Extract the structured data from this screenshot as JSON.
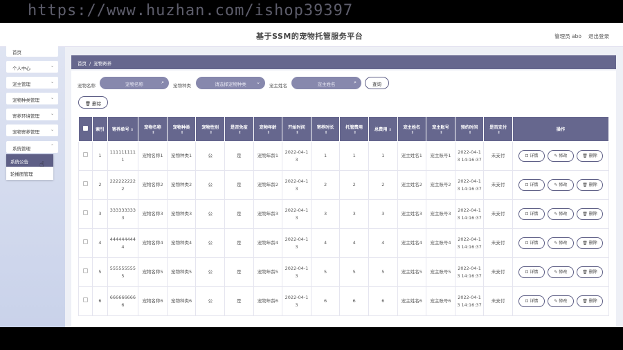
{
  "watermark": "https://www.huzhan.com/ishop39397",
  "app": {
    "title": "基于SSM的宠物托管服务平台",
    "user": "管理员 abo",
    "logout": "退出登录"
  },
  "sidebar": {
    "items": [
      {
        "label": "首页"
      },
      {
        "label": "个人中心"
      },
      {
        "label": "宠主管理"
      },
      {
        "label": "宠物种类管理"
      },
      {
        "label": "寄养环境管理"
      },
      {
        "label": "宠物寄养管理"
      },
      {
        "label": "系统管理"
      }
    ],
    "submenu": [
      {
        "label": "系统公告"
      },
      {
        "label": "轮播图管理"
      }
    ]
  },
  "breadcrumb": {
    "home": "首页",
    "sep": "/",
    "current": "宠物寄养"
  },
  "filters": {
    "name_label": "宠物名称",
    "name_placeholder": "宠物名称",
    "type_label": "宠物种类",
    "type_placeholder": "请选择宠物种类",
    "owner_label": "宠主姓名",
    "owner_placeholder": "宠主姓名",
    "query_button": "查询",
    "delete_button": "删除"
  },
  "table": {
    "columns": [
      "索引",
      "寄养单号",
      "宠物名称",
      "宠物种类",
      "宠物性别",
      "是否免疫",
      "宠物年龄",
      "开始时间",
      "寄养时长",
      "托管费用",
      "总费用",
      "宠主姓名",
      "宠主账号",
      "预约时间",
      "是否支付",
      "操作"
    ],
    "rows": [
      [
        "1",
        "1111111111",
        "宠物名称1",
        "宠物种类1",
        "公",
        "是",
        "宠物年龄1",
        "2022-04-13",
        "1",
        "1",
        "1",
        "宠主姓名1",
        "宠主账号1",
        "2022-04-13 14:16:37",
        "未支付"
      ],
      [
        "2",
        "2222222222",
        "宠物名称2",
        "宠物种类2",
        "公",
        "是",
        "宠物年龄2",
        "2022-04-13",
        "2",
        "2",
        "2",
        "宠主姓名2",
        "宠主账号2",
        "2022-04-13 14:16:37",
        "未支付"
      ],
      [
        "3",
        "3333333333",
        "宠物名称3",
        "宠物种类3",
        "公",
        "是",
        "宠物年龄3",
        "2022-04-13",
        "3",
        "3",
        "3",
        "宠主姓名3",
        "宠主账号3",
        "2022-04-13 14:16:37",
        "未支付"
      ],
      [
        "4",
        "4444444444",
        "宠物名称4",
        "宠物种类4",
        "公",
        "是",
        "宠物年龄4",
        "2022-04-13",
        "4",
        "4",
        "4",
        "宠主姓名4",
        "宠主账号4",
        "2022-04-13 14:16:37",
        "未支付"
      ],
      [
        "5",
        "5555555555",
        "宠物名称5",
        "宠物种类5",
        "公",
        "是",
        "宠物年龄5",
        "2022-04-13",
        "5",
        "5",
        "5",
        "宠主姓名5",
        "宠主账号5",
        "2022-04-13 14:16:37",
        "未支付"
      ],
      [
        "6",
        "6666666666",
        "宠物名称6",
        "宠物种类6",
        "公",
        "是",
        "宠物年龄6",
        "2022-04-13",
        "6",
        "6",
        "6",
        "宠主姓名6",
        "宠主账号6",
        "2022-04-13 14:16:37",
        "未支付"
      ]
    ],
    "actions": {
      "detail": "详情",
      "edit": "修改",
      "delete": "删除"
    }
  },
  "icons": {
    "search": "search-icon",
    "dropdown": "chevron-down-icon",
    "detail": "detail-icon",
    "edit": "edit-icon",
    "delete": "trash-icon"
  },
  "colors": {
    "accent": "#66678e",
    "sidebar": "#d3daee",
    "input": "#8788ad"
  }
}
